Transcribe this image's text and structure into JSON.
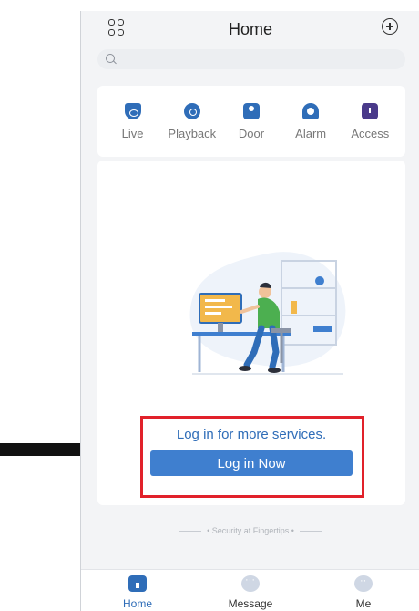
{
  "header": {
    "title": "Home"
  },
  "search": {
    "placeholder": ""
  },
  "services": [
    {
      "label": "Live",
      "icon": "camera-icon"
    },
    {
      "label": "Playback",
      "icon": "playback-icon"
    },
    {
      "label": "Door",
      "icon": "door-icon"
    },
    {
      "label": "Alarm",
      "icon": "alarm-icon"
    },
    {
      "label": "Access",
      "icon": "access-icon"
    }
  ],
  "login": {
    "prompt": "Log in for more services.",
    "button_label": "Log in Now"
  },
  "tagline": "• Security at Fingertips •",
  "tabs": [
    {
      "label": "Home",
      "active": true
    },
    {
      "label": "Message",
      "active": false
    },
    {
      "label": "Me",
      "active": false
    }
  ],
  "colors": {
    "accent": "#2f6db8",
    "button": "#3f7fcf",
    "highlight": "#e1212a"
  }
}
